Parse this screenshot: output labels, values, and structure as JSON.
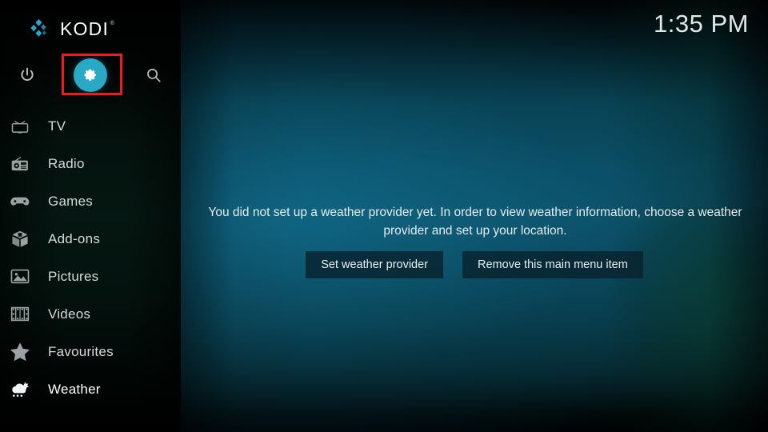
{
  "app": {
    "logo_text": "KODI",
    "logo_tm": "®",
    "logo_icon": "kodi-logo-icon"
  },
  "header": {
    "clock": "1:35 PM"
  },
  "top_bar": {
    "power_label": "Power",
    "power_icon": "power-icon",
    "settings_label": "Settings",
    "settings_icon": "gear-icon",
    "search_label": "Search",
    "search_icon": "search-icon",
    "highlight_color": "#ee1b18",
    "settings_accent_color": "#2aa9c6"
  },
  "sidebar": {
    "items": [
      {
        "label": "TV",
        "icon": "tv-icon",
        "active": false
      },
      {
        "label": "Radio",
        "icon": "radio-icon",
        "active": false
      },
      {
        "label": "Games",
        "icon": "gamepad-icon",
        "active": false
      },
      {
        "label": "Add-ons",
        "icon": "addons-box-icon",
        "active": false
      },
      {
        "label": "Pictures",
        "icon": "pictures-icon",
        "active": false
      },
      {
        "label": "Videos",
        "icon": "film-strip-icon",
        "active": false
      },
      {
        "label": "Favourites",
        "icon": "star-icon",
        "active": false
      },
      {
        "label": "Weather",
        "icon": "weather-icon",
        "active": true
      }
    ]
  },
  "main": {
    "message": "You did not set up a weather provider yet. In order to view weather information, choose a weather provider and set up your location.",
    "buttons": [
      {
        "label": "Set weather provider"
      },
      {
        "label": "Remove this main menu item"
      }
    ]
  }
}
